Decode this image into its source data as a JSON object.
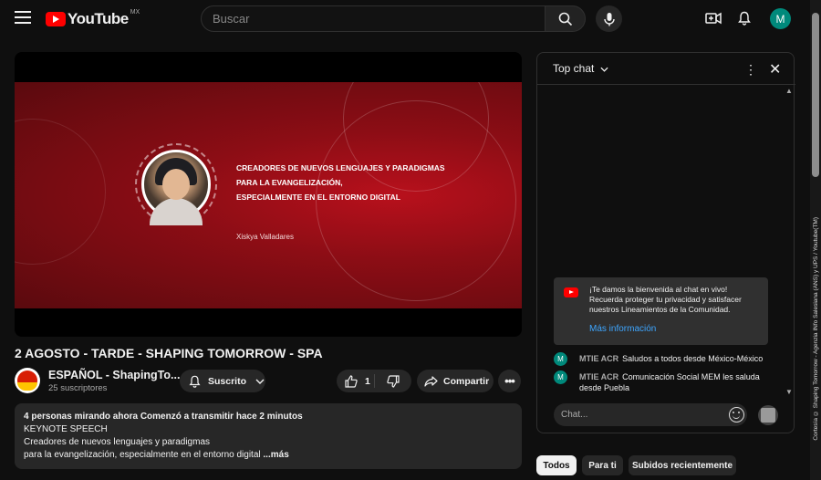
{
  "header": {
    "logo_text": "YouTube",
    "region": "MX",
    "search_placeholder": "Buscar",
    "avatar_letter": "M"
  },
  "player": {
    "banner_lines": [
      "CREADORES DE NUEVOS LENGUAJES Y PARADIGMAS",
      "PARA LA EVANGELIZACIÓN,",
      "ESPECIALMENTE EN EL ENTORNO DIGITAL"
    ],
    "speaker": "Xiskya Valladares"
  },
  "video": {
    "title": "2 AGOSTO - TARDE - SHAPING TOMORROW - SPA",
    "channel_name": "ESPAÑOL - ShapingTo...",
    "subscribers": "25 suscriptores",
    "subscribe_label": "Suscrito",
    "like_count": "1",
    "share_label": "Compartir"
  },
  "description": {
    "meta": "4 personas mirando ahora  Comenzó a transmitir hace 2 minutos",
    "line1": "KEYNOTE SPEECH",
    "line2": "Creadores de nuevos lenguajes y paradigmas",
    "line3": "para la evangelización, especialmente en el entorno digital",
    "more": " ...más"
  },
  "chat": {
    "title": "Top chat",
    "welcome_text": "¡Te damos la bienvenida al chat en vivo! Recuerda proteger tu privacidad y satisfacer nuestros Lineamientos de la Comunidad.",
    "welcome_link": "Más información",
    "messages": [
      {
        "avatar": "M",
        "author": "MTIE ACR",
        "text": "Saludos a todos desde México-México"
      },
      {
        "avatar": "M",
        "author": "MTIE ACR",
        "text": "Comunicación Social MEM les saluda desde Puebla"
      }
    ],
    "input_placeholder": "Chat..."
  },
  "chips": [
    "Todos",
    "Para ti",
    "Subidos recientemente"
  ],
  "watermark": "Cortesía © Shaping Tomorrow - Agenzia INfo Salesiana (ANS) y UPS / Youtube(TM)",
  "colors": {
    "brand_red": "#ff0000",
    "link_blue": "#3ea6ff",
    "avatar_teal": "#00897b",
    "background": "#0f0f0f"
  }
}
